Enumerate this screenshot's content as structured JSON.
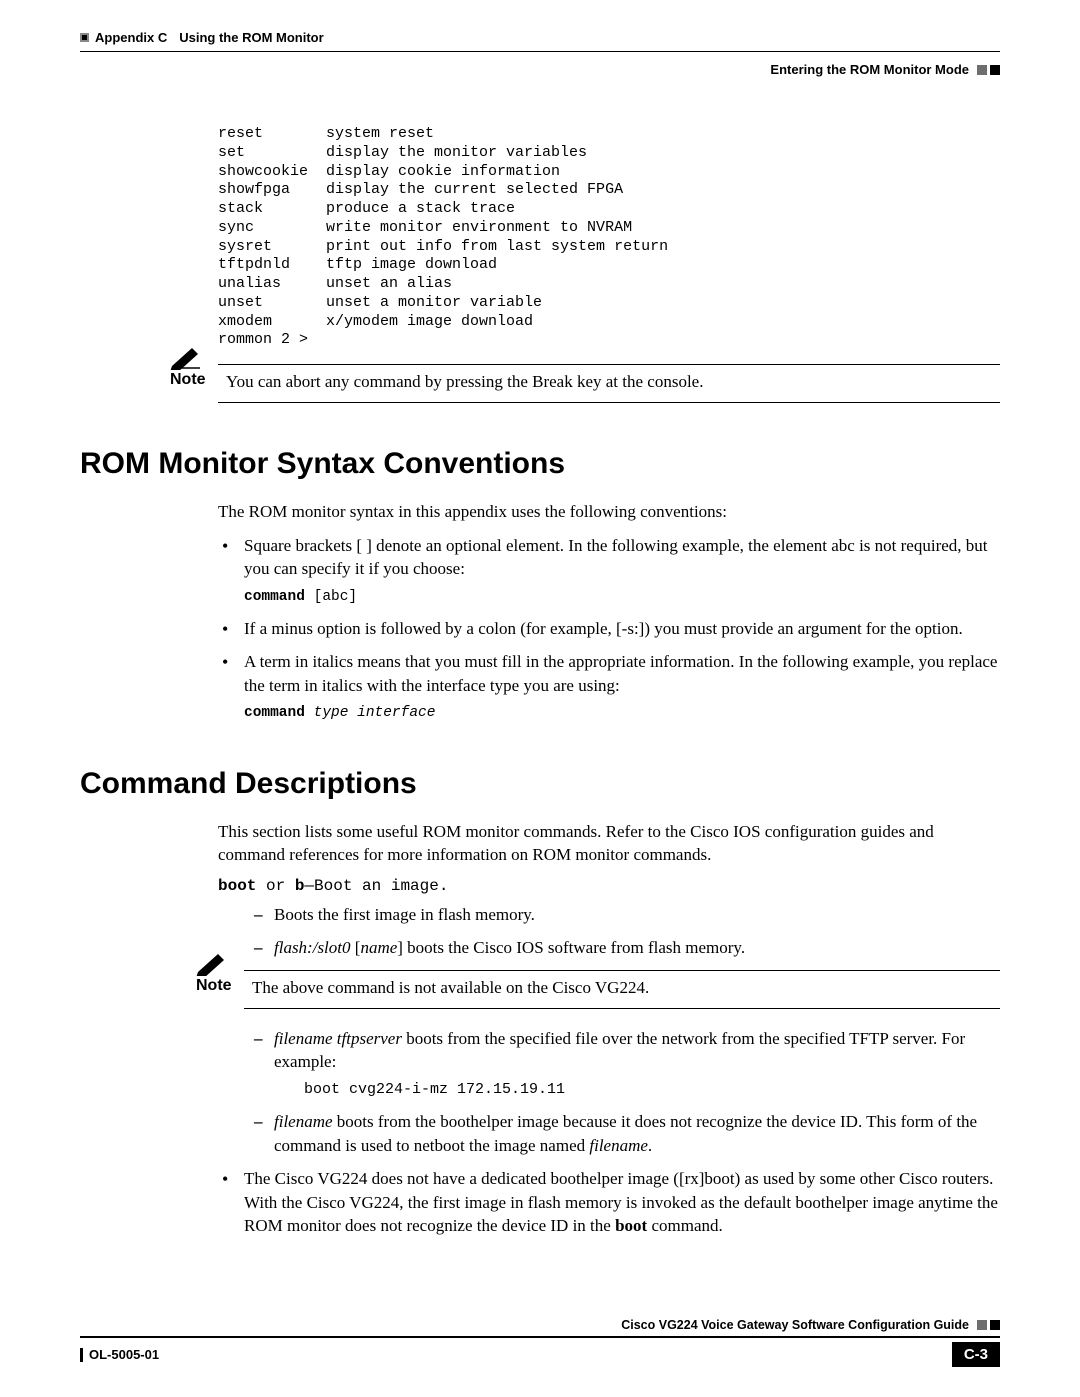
{
  "header": {
    "appendix_label": "Appendix C",
    "appendix_title": "Using the ROM Monitor",
    "section_breadcrumb": "Entering the ROM Monitor Mode"
  },
  "terminal": {
    "rows": [
      {
        "cmd": "reset",
        "desc": "system reset"
      },
      {
        "cmd": "set",
        "desc": "display the monitor variables"
      },
      {
        "cmd": "showcookie",
        "desc": "display cookie information"
      },
      {
        "cmd": "showfpga",
        "desc": "display the current selected FPGA"
      },
      {
        "cmd": "stack",
        "desc": "produce a stack trace"
      },
      {
        "cmd": "sync",
        "desc": "write monitor environment to NVRAM"
      },
      {
        "cmd": "sysret",
        "desc": "print out info from last system return"
      },
      {
        "cmd": "tftpdnld",
        "desc": "tftp image download"
      },
      {
        "cmd": "unalias",
        "desc": "unset an alias"
      },
      {
        "cmd": "unset",
        "desc": "unset a monitor variable"
      },
      {
        "cmd": "xmodem",
        "desc": "x/ymodem image download"
      }
    ],
    "prompt": "rommon 2 >"
  },
  "note1_label": "Note",
  "note1_text": "You can abort any command by pressing the Break key at the console.",
  "sections": {
    "syntax": {
      "heading": "ROM Monitor Syntax Conventions",
      "intro": "The ROM monitor syntax in this appendix uses the following conventions:",
      "bullet1": "Square brackets [ ] denote an optional element. In the following example, the element abc is not required, but you can specify it if you choose:",
      "cmd1_bold": "command",
      "cmd1_rest": " [abc]",
      "bullet2": "If a minus option is followed by a colon (for example, [-s:]) you must provide an argument for the option.",
      "bullet3": "A term in italics means that you must fill in the appropriate information. In the following example, you replace the term in italics with the interface type you are using:",
      "cmd2_bold": "command",
      "cmd2_ital": " type interface"
    },
    "cmds": {
      "heading": "Command Descriptions",
      "intro": "This section lists some useful ROM monitor commands. Refer to the Cisco IOS configuration guides and command references for more information on ROM monitor commands.",
      "boot_prefix_bold1": "boot",
      "boot_mid": " or ",
      "boot_prefix_bold2": "b",
      "boot_rest": "—Boot an image.",
      "dash1": "Boots the first image in flash memory.",
      "dash2_ital": "flash:/slot0",
      "dash2_mid": " [",
      "dash2_ital2": "name",
      "dash2_rest": "] boots the Cisco IOS software from flash memory.",
      "note2_label": "Note",
      "note2_text": "The above command is not available on the Cisco VG224.",
      "dash3_ital": "filename tftpserver",
      "dash3_rest": " boots from the specified file over the network from the specified TFTP server. For example:",
      "boot_example": "boot cvg224-i-mz 172.15.19.11",
      "dash4_ital": "filename",
      "dash4_rest_a": " boots from the boothelper image because it does not recognize the device ID. This form of the command is used to netboot the image named ",
      "dash4_ital2": "filename",
      "dash4_rest_b": ".",
      "bullet_last_a": "The Cisco VG224 does not have a dedicated boothelper image ([rx]boot) as used by some other Cisco routers. With the Cisco VG224, the first image in flash memory is invoked as the default boothelper image anytime the ROM monitor does not recognize the device ID in the ",
      "bullet_last_bold": "boot",
      "bullet_last_b": " command."
    }
  },
  "footer": {
    "guide_title": "Cisco VG224 Voice Gateway Software Configuration Guide",
    "doc_id": "OL-5005-01",
    "page_num": "C-3"
  }
}
